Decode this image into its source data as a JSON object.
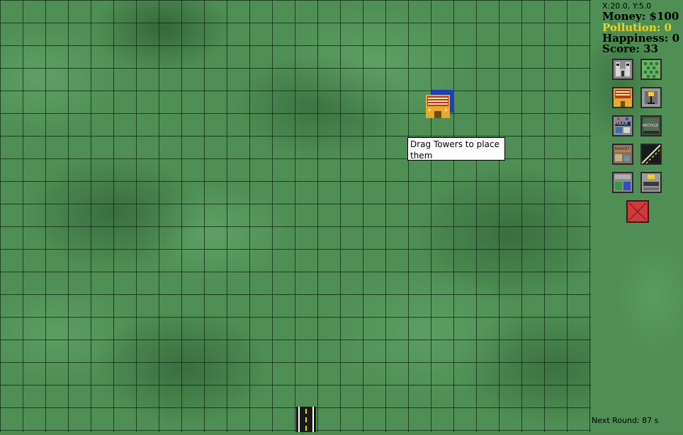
{
  "hud": {
    "coords": "X:20.0, Y:5.0",
    "money": "Money: $100",
    "pollution": "Pollution: 0",
    "happiness": "Happiness: 0",
    "score": "Score: 33"
  },
  "tooltip": "Drag Towers to place them",
  "next_round": "Next Round: 87 s",
  "towers": [
    {
      "id": "factory",
      "label": ""
    },
    {
      "id": "park",
      "label": ""
    },
    {
      "id": "school",
      "label": ""
    },
    {
      "id": "traffic-light",
      "label": ""
    },
    {
      "id": "police",
      "label": "POLICE"
    },
    {
      "id": "recycle",
      "label": "RECYCLE"
    },
    {
      "id": "market",
      "label": "MARKET"
    },
    {
      "id": "road",
      "label": ""
    },
    {
      "id": "clinic",
      "label": ""
    },
    {
      "id": "bus-station",
      "label": ""
    },
    {
      "id": "delete",
      "label": ""
    }
  ],
  "colors": {
    "pollution": "#f2d21a",
    "grass": "#4f8f55",
    "grid_line": "#14321a",
    "delete_button": "#d03a3a"
  }
}
